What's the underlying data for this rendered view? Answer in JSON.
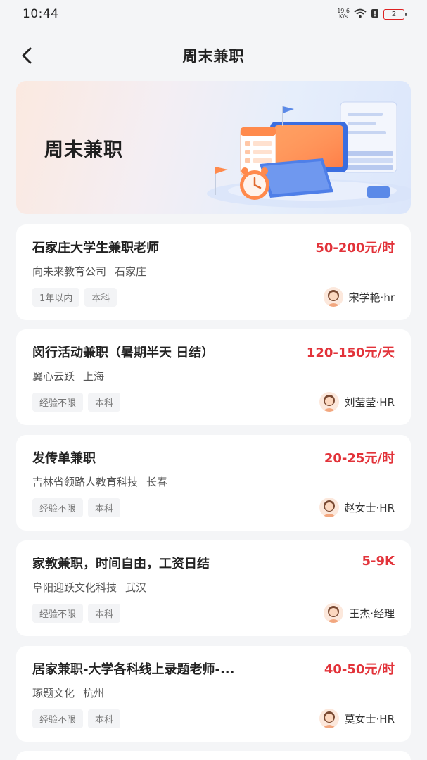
{
  "status_bar": {
    "time": "10:44",
    "net_speed_value": "19.6",
    "net_speed_unit": "K/s",
    "battery": "2"
  },
  "header": {
    "title": "周末兼职"
  },
  "banner": {
    "title": "周末兼职"
  },
  "jobs": [
    {
      "title": "石家庄大学生兼职老师",
      "salary": "50-200元/时",
      "company": "向未来教育公司",
      "city": "石家庄",
      "tags": [
        "1年以内",
        "本科"
      ],
      "recruiter": "宋学艳·hr"
    },
    {
      "title": "闵行活动兼职（暑期半天 日结）",
      "salary": "120-150元/天",
      "company": "翼心云跃",
      "city": "上海",
      "tags": [
        "经验不限",
        "本科"
      ],
      "recruiter": "刘莹莹·HR"
    },
    {
      "title": "发传单兼职",
      "salary": "20-25元/时",
      "company": "吉林省领路人教育科技",
      "city": "长春",
      "tags": [
        "经验不限",
        "本科"
      ],
      "recruiter": "赵女士·HR"
    },
    {
      "title": "家教兼职，时间自由，工资日结",
      "salary": "5-9K",
      "company": "阜阳迎跃文化科技",
      "city": "武汉",
      "tags": [
        "经验不限",
        "本科"
      ],
      "recruiter": "王杰·经理"
    },
    {
      "title": "居家兼职-大学各科线上录题老师-...",
      "salary": "40-50元/时",
      "company": "琢题文化",
      "city": "杭州",
      "tags": [
        "经验不限",
        "本科"
      ],
      "recruiter": "莫女士·HR"
    }
  ],
  "colors": {
    "salary": "#e2333a",
    "background": "#f4f5f7",
    "card": "#ffffff"
  },
  "icons": {
    "back": "chevron-left-icon",
    "wifi": "wifi-icon",
    "alert": "alert-icon",
    "battery": "battery-icon",
    "avatar": "avatar-icon"
  }
}
